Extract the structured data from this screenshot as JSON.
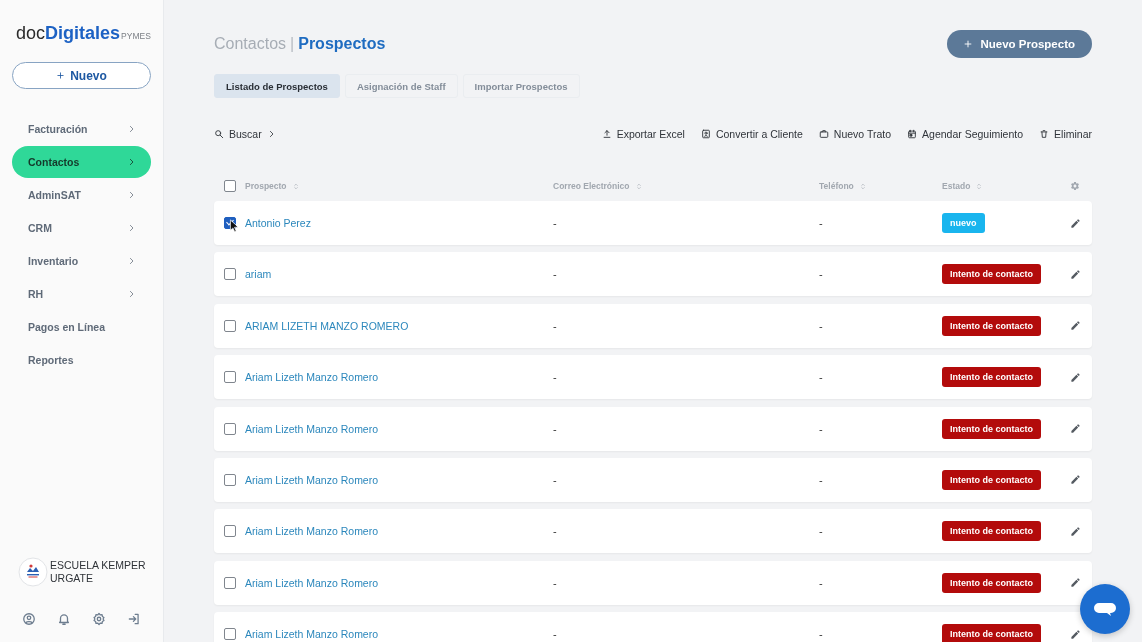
{
  "sidebar": {
    "logo": {
      "prefix": "doc",
      "brand": "Digitales",
      "suffix": "PYMES"
    },
    "new_button": {
      "label": "Nuevo"
    },
    "items": [
      {
        "label": "Facturación",
        "selected": false,
        "submenu": true
      },
      {
        "label": "Contactos",
        "selected": true,
        "submenu": true
      },
      {
        "label": "AdminSAT",
        "selected": false,
        "submenu": true
      },
      {
        "label": "CRM",
        "selected": false,
        "submenu": true
      },
      {
        "label": "Inventario",
        "selected": false,
        "submenu": true
      },
      {
        "label": "RH",
        "selected": false,
        "submenu": true
      },
      {
        "label": "Pagos en Línea",
        "selected": false,
        "submenu": false
      },
      {
        "label": "Reportes",
        "selected": false,
        "submenu": false
      }
    ],
    "account": {
      "name": "ESCUELA KEMPER URGATE"
    }
  },
  "header": {
    "breadcrumb": {
      "section": "Contactos",
      "separator": "|",
      "page": "Prospectos"
    },
    "primary_button": {
      "label": "Nuevo Prospecto"
    }
  },
  "tabs": [
    {
      "label": "Listado de Prospectos",
      "selected": true
    },
    {
      "label": "Asignación de Staff",
      "selected": false
    },
    {
      "label": "Importar Prospectos",
      "selected": false
    }
  ],
  "toolbar": {
    "search": {
      "label": "Buscar"
    },
    "actions": [
      {
        "kind": "export",
        "label": "Exportar Excel"
      },
      {
        "kind": "convert",
        "label": "Convertir a Cliente"
      },
      {
        "kind": "deal",
        "label": "Nuevo Trato"
      },
      {
        "kind": "schedule",
        "label": "Agendar Seguimiento"
      },
      {
        "kind": "delete",
        "label": "Eliminar"
      }
    ]
  },
  "table": {
    "select_all": {
      "checked": false
    },
    "columns": [
      "Prospecto",
      "Correo Electrónico",
      "Teléfono",
      "Estado"
    ],
    "rows": [
      {
        "checked": true,
        "name": "Antonio Perez",
        "email": "-",
        "phone": "-",
        "status": {
          "label": "nuevo",
          "color": "#19b5ee"
        }
      },
      {
        "checked": false,
        "name": "ariam",
        "email": "-",
        "phone": "-",
        "status": {
          "label": "Intento de contacto",
          "color": "#b30b0b"
        }
      },
      {
        "checked": false,
        "name": "ARIAM LIZETH MANZO ROMERO",
        "email": "-",
        "phone": "-",
        "status": {
          "label": "Intento de contacto",
          "color": "#b30b0b"
        }
      },
      {
        "checked": false,
        "name": "Ariam Lizeth Manzo Romero",
        "email": "-",
        "phone": "-",
        "status": {
          "label": "Intento de contacto",
          "color": "#b30b0b"
        }
      },
      {
        "checked": false,
        "name": "Ariam Lizeth Manzo Romero",
        "email": "-",
        "phone": "-",
        "status": {
          "label": "Intento de contacto",
          "color": "#b30b0b"
        }
      },
      {
        "checked": false,
        "name": "Ariam Lizeth Manzo Romero",
        "email": "-",
        "phone": "-",
        "status": {
          "label": "Intento de contacto",
          "color": "#b30b0b"
        }
      },
      {
        "checked": false,
        "name": "Ariam Lizeth Manzo Romero",
        "email": "-",
        "phone": "-",
        "status": {
          "label": "Intento de contacto",
          "color": "#b30b0b"
        }
      },
      {
        "checked": false,
        "name": "Ariam Lizeth Manzo Romero",
        "email": "-",
        "phone": "-",
        "status": {
          "label": "Intento de contacto",
          "color": "#b30b0b"
        }
      },
      {
        "checked": false,
        "name": "Ariam Lizeth Manzo Romero",
        "email": "-",
        "phone": "-",
        "status": {
          "label": "Intento de contacto",
          "color": "#b30b0b"
        }
      }
    ]
  }
}
